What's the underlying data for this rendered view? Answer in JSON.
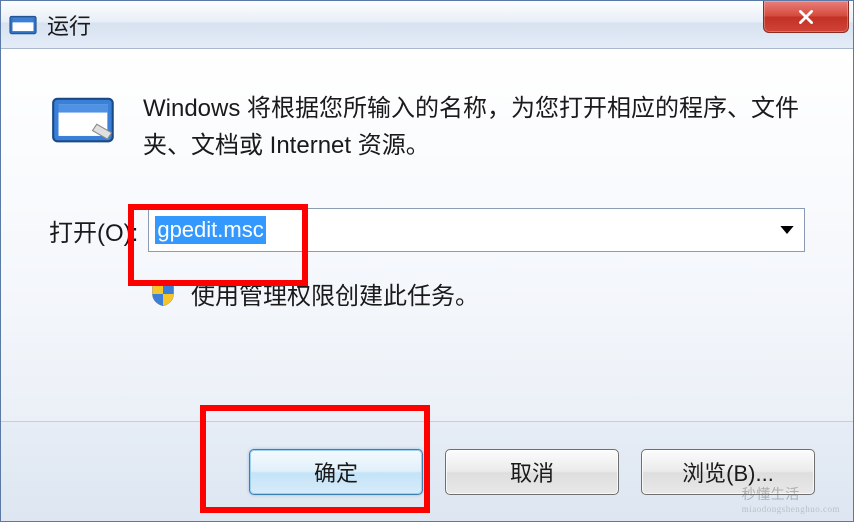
{
  "title": "运行",
  "description": "Windows 将根据您所输入的名称，为您打开相应的程序、文件夹、文档或 Internet 资源。",
  "open_label": "打开(O):",
  "open_value": "gpedit.msc",
  "admin_note": "使用管理权限创建此任务。",
  "buttons": {
    "ok": "确定",
    "cancel": "取消",
    "browse": "浏览(B)..."
  },
  "icons": {
    "title_icon": "run-icon",
    "close_icon": "close-icon",
    "run_icon": "run-icon-large",
    "shield_icon": "shield-icon",
    "dropdown_icon": "chevron-down-icon"
  },
  "watermark": {
    "main": "秒懂生活",
    "sub": "miaodongshenghuo.com"
  }
}
